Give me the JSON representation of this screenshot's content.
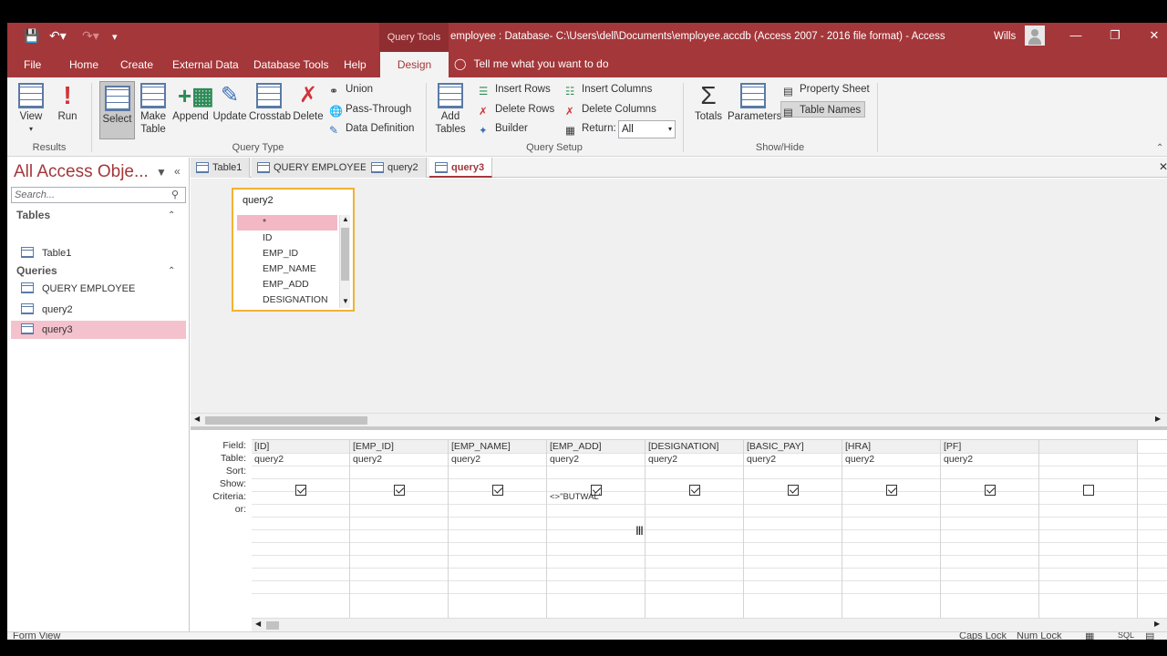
{
  "titlebar": {
    "context_tab": "Query Tools",
    "title": "employee : Database- C:\\Users\\dell\\Documents\\employee.accdb (Access 2007 - 2016 file format)  -  Access",
    "user": "Wills",
    "minimize": "—",
    "maximize": "❐",
    "close": "✕"
  },
  "menu": {
    "tabs": [
      "File",
      "Home",
      "Create",
      "External Data",
      "Database Tools",
      "Help",
      "Design"
    ],
    "tell_me": "Tell me what you want to do"
  },
  "ribbon": {
    "results": {
      "view": "View",
      "run": "Run",
      "group": "Results"
    },
    "query_type": {
      "select": "Select",
      "make_table_1": "Make",
      "make_table_2": "Table",
      "append": "Append",
      "update": "Update",
      "crosstab": "Crosstab",
      "delete": "Delete",
      "union": "Union",
      "pass_through": "Pass-Through",
      "data_definition": "Data Definition",
      "group": "Query Type"
    },
    "query_setup": {
      "add_tables_1": "Add",
      "add_tables_2": "Tables",
      "insert_rows": "Insert Rows",
      "delete_rows": "Delete Rows",
      "builder": "Builder",
      "insert_columns": "Insert Columns",
      "delete_columns": "Delete Columns",
      "return_label": "Return:",
      "return_value": "All",
      "group": "Query Setup"
    },
    "show_hide": {
      "totals": "Totals",
      "parameters": "Parameters",
      "property_sheet": "Property Sheet",
      "table_names": "Table Names",
      "group": "Show/Hide"
    }
  },
  "nav": {
    "title": "All Access Obje...",
    "search_placeholder": "Search...",
    "tables_header": "Tables",
    "tables": [
      "Table1"
    ],
    "queries_header": "Queries",
    "queries": [
      "QUERY EMPLOYEE",
      "query2",
      "query3"
    ],
    "selected": "query3"
  },
  "doc_tabs": [
    "Table1",
    "QUERY EMPLOYEE",
    "query2",
    "query3"
  ],
  "active_doc_tab": "query3",
  "table_box": {
    "title": "query2",
    "fields": [
      "*",
      "ID",
      "EMP_ID",
      "EMP_NAME",
      "EMP_ADD",
      "DESIGNATION"
    ]
  },
  "grid": {
    "row_labels": [
      "Field:",
      "Table:",
      "Sort:",
      "Show:",
      "Criteria:",
      "or:"
    ],
    "columns": [
      {
        "field": "[ID]",
        "table": "query2",
        "show": true,
        "criteria": ""
      },
      {
        "field": "[EMP_ID]",
        "table": "query2",
        "show": true,
        "criteria": ""
      },
      {
        "field": "[EMP_NAME]",
        "table": "query2",
        "show": true,
        "criteria": ""
      },
      {
        "field": "[EMP_ADD]",
        "table": "query2",
        "show": true,
        "criteria": "<>\"BUTWAL\""
      },
      {
        "field": "[DESIGNATION]",
        "table": "query2",
        "show": true,
        "criteria": ""
      },
      {
        "field": "[BASIC_PAY]",
        "table": "query2",
        "show": true,
        "criteria": ""
      },
      {
        "field": "[HRA]",
        "table": "query2",
        "show": true,
        "criteria": ""
      },
      {
        "field": "[PF]",
        "table": "query2",
        "show": true,
        "criteria": ""
      },
      {
        "field": "",
        "table": "",
        "show": false,
        "criteria": ""
      }
    ]
  },
  "status": {
    "left": "Form View",
    "caps": "Caps Lock",
    "num": "Num Lock",
    "sql": "SQL"
  },
  "colors": {
    "accent": "#a4373a",
    "selection": "#f4c2cc",
    "table_border": "#f2b233"
  }
}
